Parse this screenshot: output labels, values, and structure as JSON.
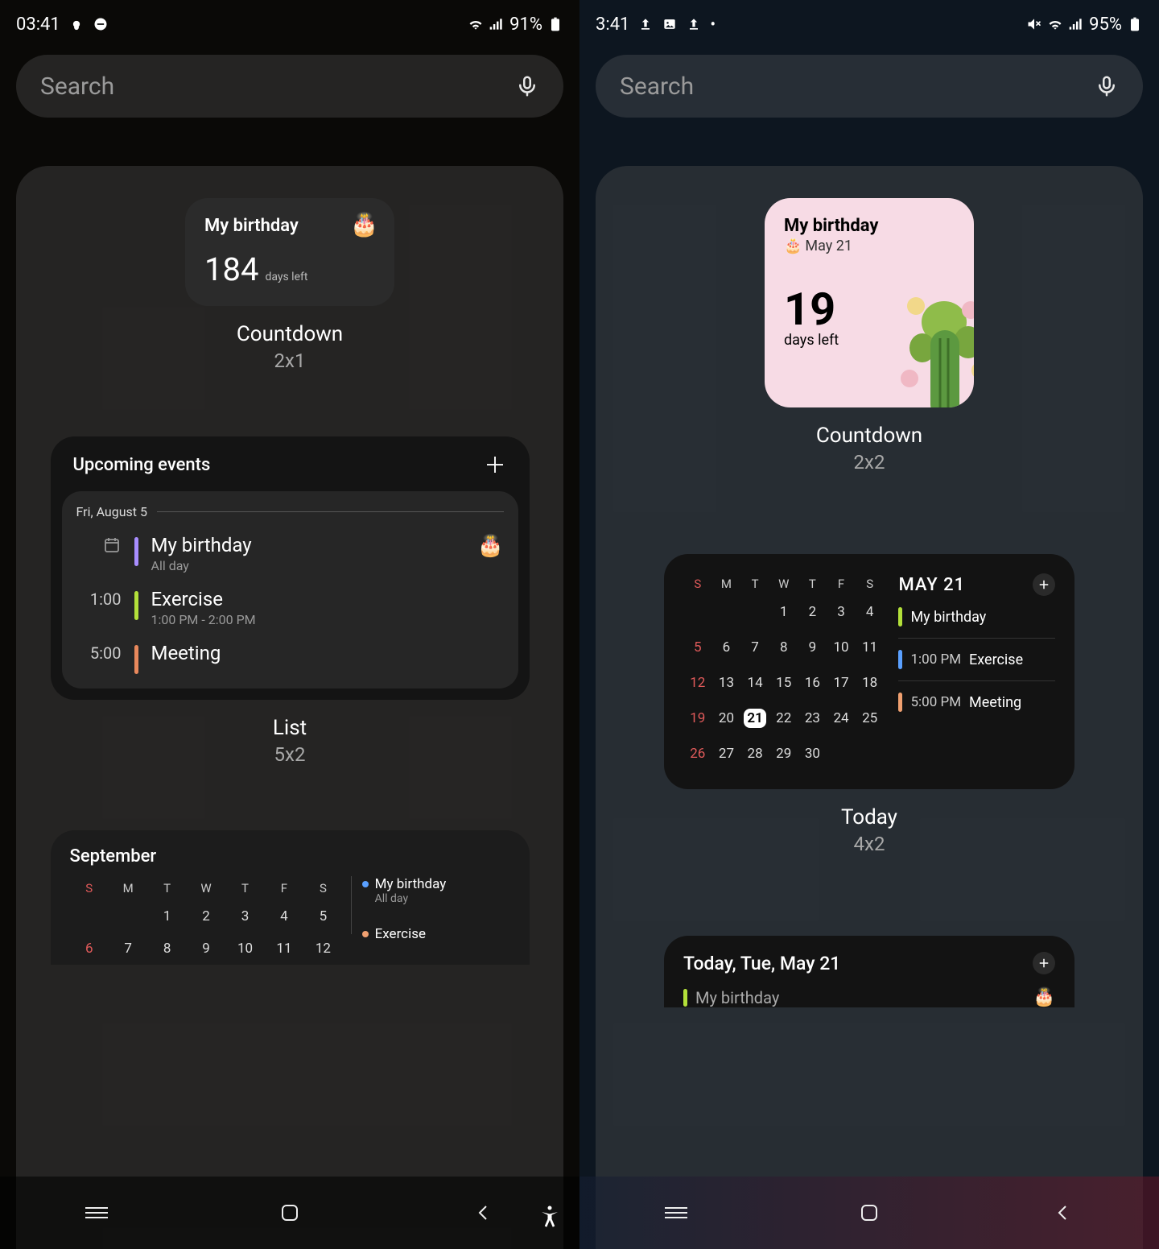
{
  "left": {
    "status": {
      "time": "03:41",
      "battery": "91%"
    },
    "search": {
      "placeholder": "Search"
    },
    "countdown": {
      "title": "My birthday",
      "number": "184",
      "sub": "days left",
      "widget_name": "Countdown",
      "widget_size": "2x1"
    },
    "list": {
      "header": "Upcoming events",
      "date": "Fri, August 5",
      "events": [
        {
          "time_icon": true,
          "title": "My birthday",
          "sub": "All day",
          "emoji": "🎂"
        },
        {
          "time": "1:00",
          "title": "Exercise",
          "sub": "1:00 PM - 2:00 PM"
        },
        {
          "time": "5:00",
          "title": "Meeting"
        }
      ],
      "widget_name": "List",
      "widget_size": "5x2"
    },
    "month": {
      "header": "September",
      "dow": [
        "S",
        "M",
        "T",
        "W",
        "T",
        "F",
        "S"
      ],
      "rows": [
        [
          "",
          "",
          "",
          "1",
          "2",
          "3",
          "4",
          "5"
        ],
        [
          "6",
          "7",
          "8",
          "9",
          "10",
          "11",
          "12"
        ]
      ],
      "events": [
        {
          "title": "My birthday",
          "sub": "All day"
        },
        {
          "title": "Exercise",
          "sub": ""
        }
      ]
    }
  },
  "right": {
    "status": {
      "time": "3:41",
      "battery": "95%"
    },
    "search": {
      "placeholder": "Search"
    },
    "countdown": {
      "title": "My birthday",
      "date": "May 21",
      "number": "19",
      "sub": "days left",
      "widget_name": "Countdown",
      "widget_size": "2x2"
    },
    "today": {
      "dow": [
        "S",
        "M",
        "T",
        "W",
        "T",
        "F",
        "S"
      ],
      "month_label": "MAY 21",
      "rows": [
        [
          "",
          "",
          "",
          "1",
          "2",
          "3",
          "4"
        ],
        [
          "5",
          "6",
          "7",
          "8",
          "9",
          "10",
          "11"
        ],
        [
          "12",
          "13",
          "14",
          "15",
          "16",
          "17",
          "18"
        ],
        [
          "19",
          "20",
          "21",
          "22",
          "23",
          "24",
          "25"
        ],
        [
          "26",
          "27",
          "28",
          "29",
          "30",
          "",
          ""
        ]
      ],
      "today_day": "21",
      "events": [
        {
          "bar": "green",
          "time": "",
          "label": "My birthday"
        },
        {
          "bar": "blue",
          "time": "1:00 PM",
          "label": "Exercise"
        },
        {
          "bar": "orange",
          "time": "5:00 PM",
          "label": "Meeting"
        }
      ],
      "widget_name": "Today",
      "widget_size": "4x2"
    },
    "todaylist": {
      "header": "Today, Tue, May 21",
      "event": {
        "label": "My birthday",
        "emoji": "🎂"
      }
    }
  }
}
